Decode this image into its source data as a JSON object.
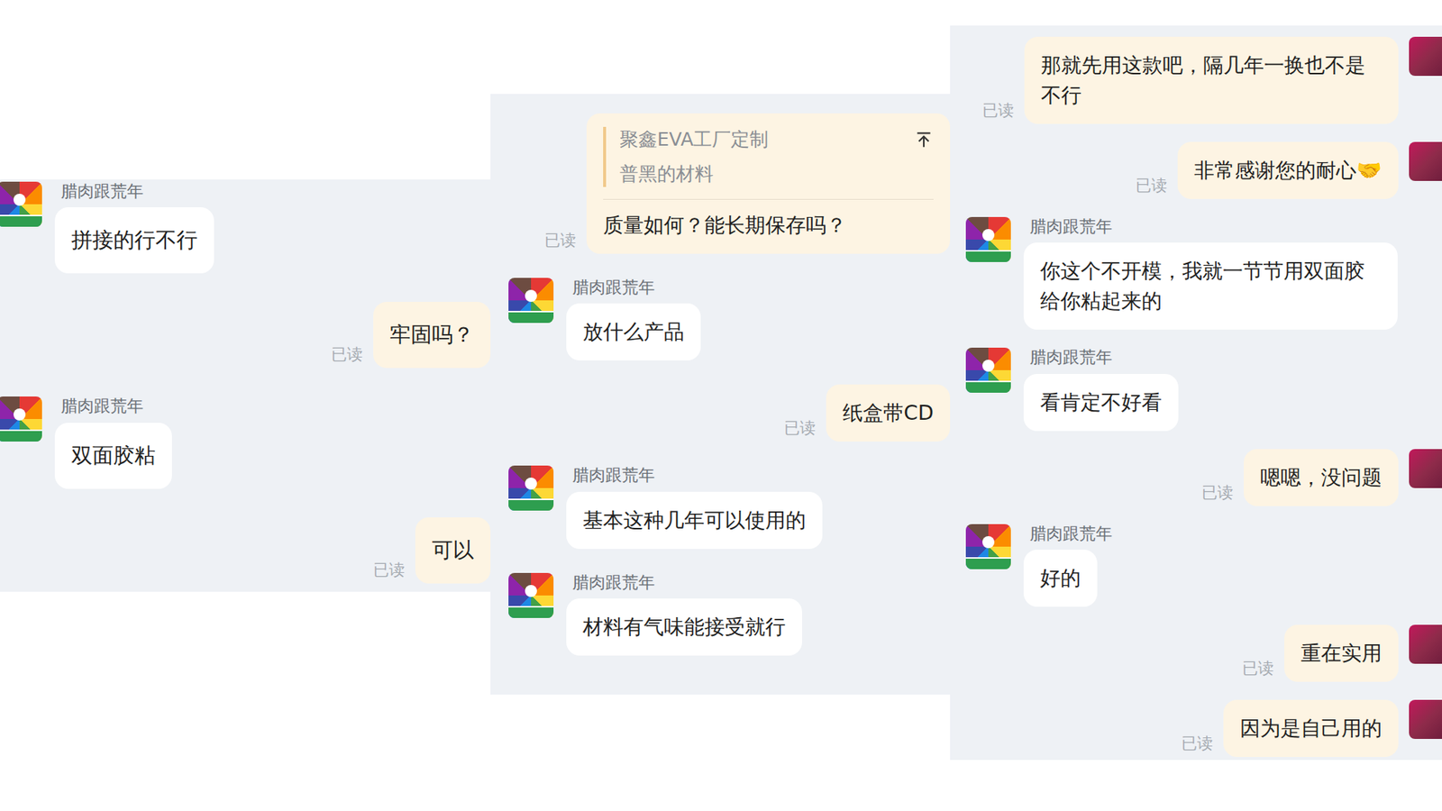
{
  "panels": [
    {
      "messages": [
        {
          "from": "other",
          "name": "腊肉跟荒年",
          "text": "拼接的行不行"
        },
        {
          "from": "me",
          "read": "已读",
          "text": "牢固吗？"
        },
        {
          "from": "other",
          "name": "腊肉跟荒年",
          "text": "双面胶粘"
        },
        {
          "from": "me",
          "read": "已读",
          "text": "可以"
        }
      ]
    },
    {
      "messages": [
        {
          "from": "me",
          "read": "已读",
          "quote": {
            "title": "聚鑫EVA工厂定制",
            "text": "普黑的材料"
          },
          "text": "质量如何？能长期保存吗？"
        },
        {
          "from": "other",
          "name": "腊肉跟荒年",
          "text": "放什么产品"
        },
        {
          "from": "me",
          "read": "已读",
          "text": "纸盒带CD"
        },
        {
          "from": "other",
          "name": "腊肉跟荒年",
          "text": "基本这种几年可以使用的"
        },
        {
          "from": "other",
          "name": "腊肉跟荒年",
          "text": "材料有气味能接受就行"
        }
      ]
    },
    {
      "messages": [
        {
          "from": "me",
          "read": "已读",
          "text": "那就先用这款吧，隔几年一换也不是不行"
        },
        {
          "from": "me",
          "read": "已读",
          "text": "非常感谢您的耐心🤝"
        },
        {
          "from": "other",
          "name": "腊肉跟荒年",
          "text": "你这个不开模，我就一节节用双面胶给你粘起来的"
        },
        {
          "from": "other",
          "name": "腊肉跟荒年",
          "text": "看肯定不好看"
        },
        {
          "from": "me",
          "read": "已读",
          "text": "嗯嗯，没问题"
        },
        {
          "from": "other",
          "name": "腊肉跟荒年",
          "text": "好的"
        },
        {
          "from": "me",
          "read": "已读",
          "text": "重在实用"
        },
        {
          "from": "me",
          "read": "已读",
          "text": "因为是自己用的"
        }
      ]
    }
  ]
}
